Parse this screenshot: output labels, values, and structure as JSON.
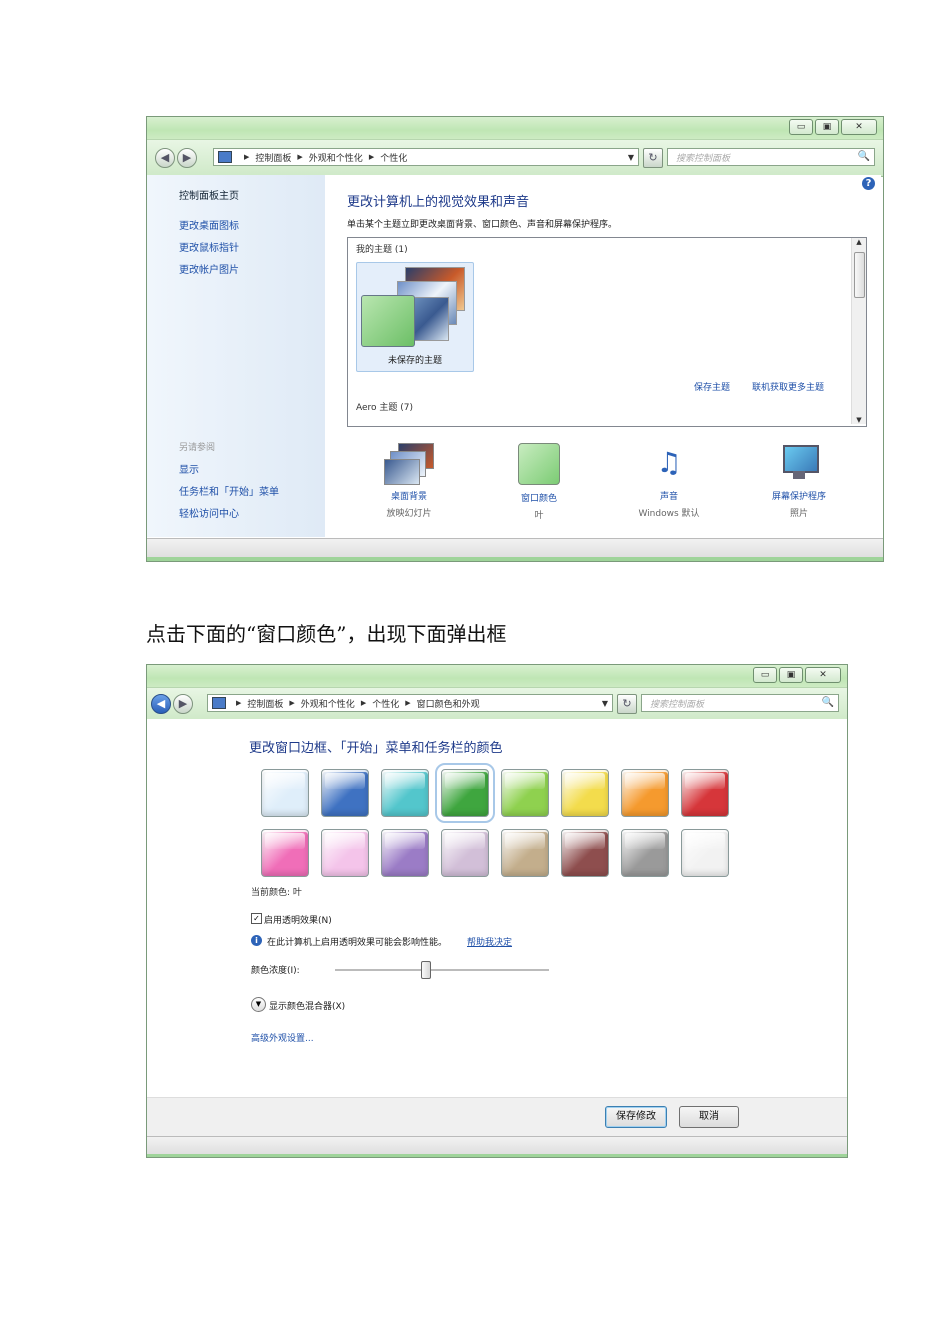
{
  "window1": {
    "buttons": {
      "minimize": "▭",
      "maximize": "▣",
      "close": "✕"
    },
    "breadcrumb": [
      "控制面板",
      "外观和个性化",
      "个性化"
    ],
    "search_placeholder": "搜索控制面板",
    "sidebar": {
      "home": "控制面板主页",
      "links": [
        "更改桌面图标",
        "更改鼠标指针",
        "更改帐户图片"
      ],
      "see_also_title": "另请参阅",
      "see_also": [
        "显示",
        "任务栏和「开始」菜单",
        "轻松访问中心"
      ]
    },
    "main": {
      "title": "更改计算机上的视觉效果和声音",
      "subtitle": "单击某个主题立即更改桌面背景、窗口颜色、声音和屏幕保护程序。",
      "my_themes": "我的主题 (1)",
      "unsaved_theme": "未保存的主题",
      "save_theme": "保存主题",
      "get_more": "联机获取更多主题",
      "aero_themes": "Aero 主题 (7)"
    },
    "bottom_items": [
      {
        "label": "桌面背景",
        "sub": "放映幻灯片",
        "icon": "desktop-background-icon"
      },
      {
        "label": "窗口颜色",
        "sub": "叶",
        "icon": "window-color-icon"
      },
      {
        "label": "声音",
        "sub": "Windows 默认",
        "icon": "sound-icon"
      },
      {
        "label": "屏幕保护程序",
        "sub": "照片",
        "icon": "screensaver-icon"
      }
    ]
  },
  "caption": "点击下面的“窗口颜色”，出现下面弹出框",
  "window2": {
    "breadcrumb": [
      "控制面板",
      "外观和个性化",
      "个性化",
      "窗口颜色和外观"
    ],
    "search_placeholder": "搜索控制面板",
    "title": "更改窗口边框、「开始」菜单和任务栏的颜色",
    "swatches_row1": [
      "#dfeefa",
      "#3f72c2",
      "#53c6cc",
      "#3fa63f",
      "#8fd14f",
      "#f3dc4c",
      "#f59a2e",
      "#d6363a"
    ],
    "swatches_row2": [
      "#f06eb8",
      "#f4c4ea",
      "#9b7cc6",
      "#d2bfd8",
      "#c3ae8c",
      "#8e4e4e",
      "#9a9a9a",
      "#f2f2f2"
    ],
    "current_color": "当前颜色: 叶",
    "transparency": "启用透明效果(N)",
    "info": "在此计算机上启用透明效果可能会影响性能。",
    "help_link": "帮助我决定",
    "intensity_label": "颜色浓度(I):",
    "intensity_value": 0.42,
    "mixer": "显示颜色混合器(X)",
    "advanced": "高级外观设置...",
    "save_button": "保存修改",
    "cancel_button": "取消"
  }
}
